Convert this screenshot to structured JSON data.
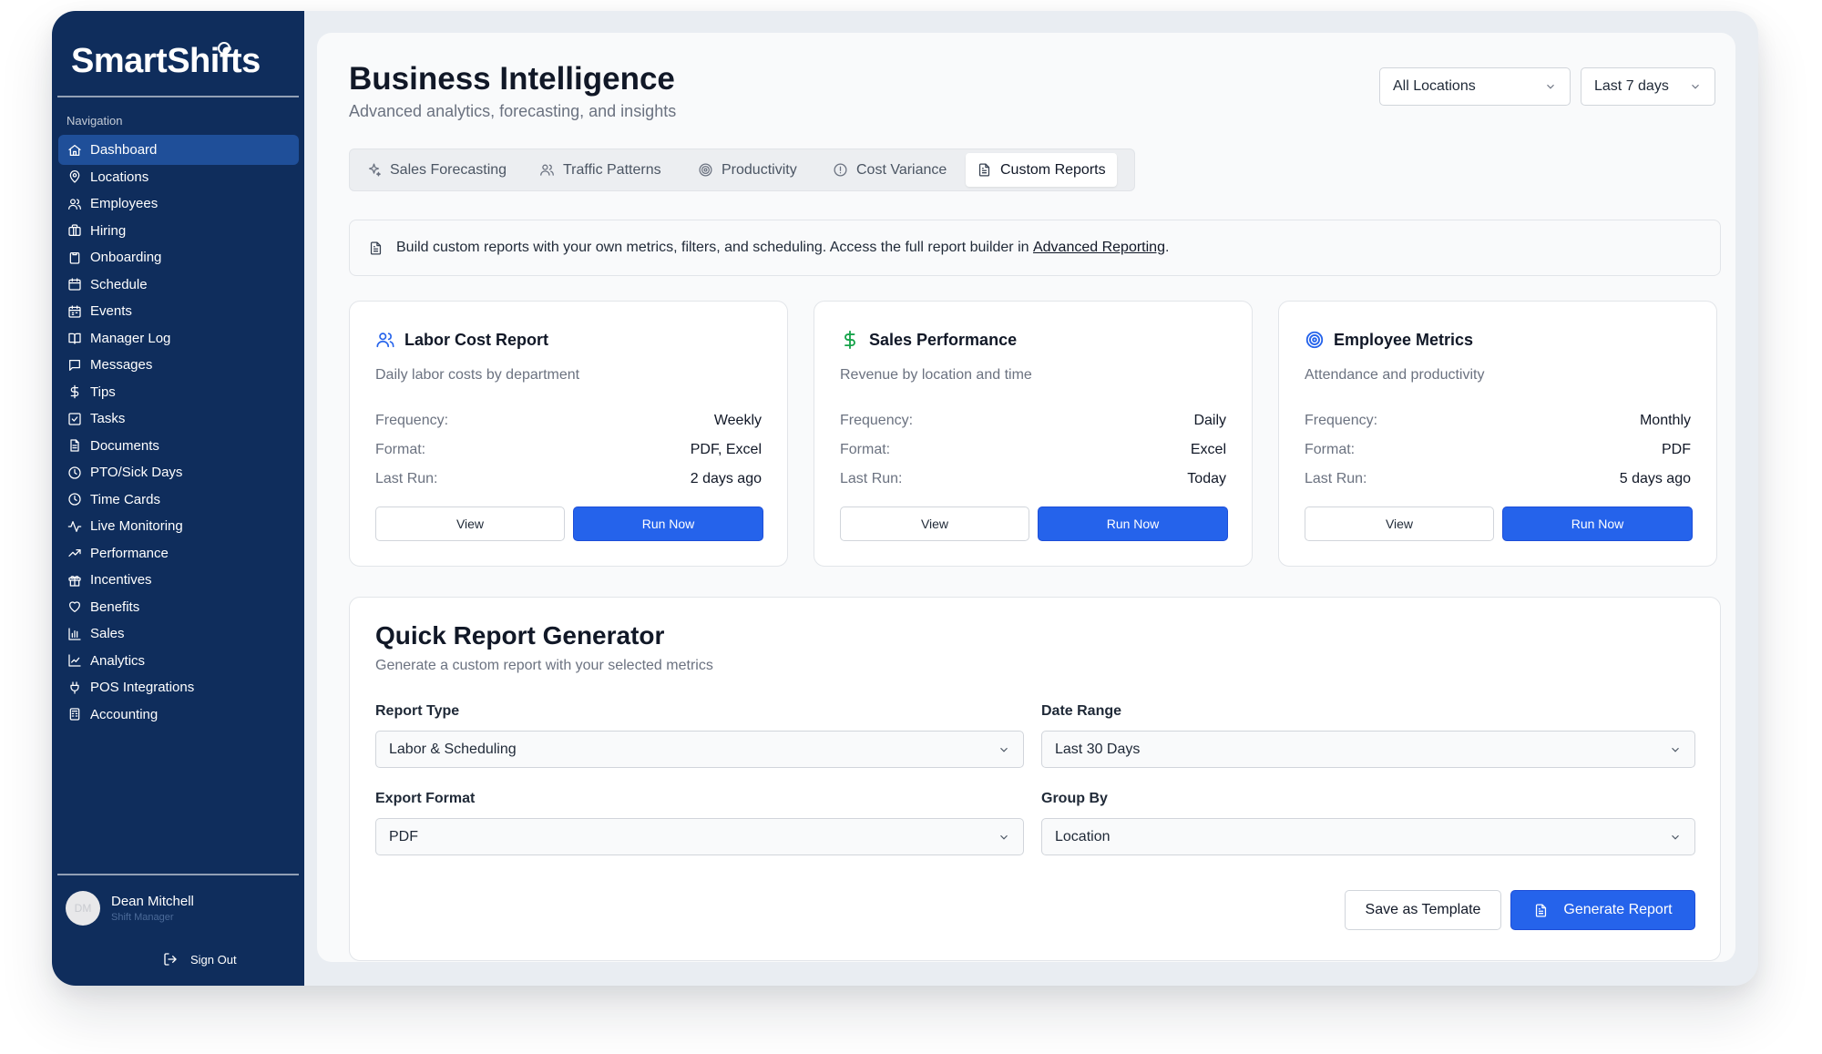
{
  "app": {
    "name": "SmartShifts"
  },
  "sidebar": {
    "heading": "Navigation",
    "items": [
      {
        "label": "Dashboard",
        "icon": "home-icon",
        "active": true
      },
      {
        "label": "Locations",
        "icon": "map-pin-icon"
      },
      {
        "label": "Employees",
        "icon": "users-icon"
      },
      {
        "label": "Hiring",
        "icon": "briefcase-icon"
      },
      {
        "label": "Onboarding",
        "icon": "clipboard-icon"
      },
      {
        "label": "Schedule",
        "icon": "calendar-icon"
      },
      {
        "label": "Events",
        "icon": "calendar-event-icon"
      },
      {
        "label": "Manager Log",
        "icon": "book-icon"
      },
      {
        "label": "Messages",
        "icon": "message-icon"
      },
      {
        "label": "Tips",
        "icon": "dollar-icon"
      },
      {
        "label": "Tasks",
        "icon": "check-square-icon"
      },
      {
        "label": "Documents",
        "icon": "file-icon"
      },
      {
        "label": "PTO/Sick Days",
        "icon": "clock-icon"
      },
      {
        "label": "Time Cards",
        "icon": "clock-icon"
      },
      {
        "label": "Live Monitoring",
        "icon": "activity-icon"
      },
      {
        "label": "Performance",
        "icon": "trending-up-icon"
      },
      {
        "label": "Incentives",
        "icon": "gift-icon"
      },
      {
        "label": "Benefits",
        "icon": "heart-icon"
      },
      {
        "label": "Sales",
        "icon": "bar-chart-icon"
      },
      {
        "label": "Analytics",
        "icon": "line-chart-icon"
      },
      {
        "label": "POS Integrations",
        "icon": "plug-icon"
      },
      {
        "label": "Accounting",
        "icon": "calculator-icon"
      }
    ],
    "user": {
      "initials": "DM",
      "name": "Dean Mitchell",
      "role": "Shift Manager"
    },
    "sign_out": "Sign Out"
  },
  "header": {
    "title": "Business Intelligence",
    "subtitle": "Advanced analytics, forecasting, and insights",
    "location_filter": "All Locations",
    "range_filter": "Last 7 days"
  },
  "tabs": [
    {
      "label": "Sales Forecasting",
      "icon": "sparkles-icon"
    },
    {
      "label": "Traffic Patterns",
      "icon": "users-icon"
    },
    {
      "label": "Productivity",
      "icon": "target-icon"
    },
    {
      "label": "Cost Variance",
      "icon": "alert-circle-icon"
    },
    {
      "label": "Custom Reports",
      "icon": "file-text-icon",
      "active": true
    }
  ],
  "notice": {
    "text": "Build custom reports with your own metrics, filters, and scheduling. Access the full report builder in ",
    "link": "Advanced Reporting",
    "suffix": "."
  },
  "labels": {
    "frequency": "Frequency:",
    "format": "Format:",
    "last_run": "Last Run:",
    "view": "View",
    "run_now": "Run Now"
  },
  "reports": [
    {
      "title": "Labor Cost Report",
      "description": "Daily labor costs by department",
      "frequency": "Weekly",
      "format": "PDF, Excel",
      "last_run": "2 days ago",
      "icon": "users-icon",
      "icon_color": "#2563eb"
    },
    {
      "title": "Sales Performance",
      "description": "Revenue by location and time",
      "frequency": "Daily",
      "format": "Excel",
      "last_run": "Today",
      "icon": "dollar-icon",
      "icon_color": "#16a34a"
    },
    {
      "title": "Employee Metrics",
      "description": "Attendance and productivity",
      "frequency": "Monthly",
      "format": "PDF",
      "last_run": "5 days ago",
      "icon": "target-icon",
      "icon_color": "#2563eb"
    }
  ],
  "quick_report": {
    "title": "Quick Report Generator",
    "subtitle": "Generate a custom report with your selected metrics",
    "report_type": {
      "label": "Report Type",
      "value": "Labor & Scheduling"
    },
    "date_range": {
      "label": "Date Range",
      "value": "Last 30 Days"
    },
    "export_format": {
      "label": "Export Format",
      "value": "PDF"
    },
    "group_by": {
      "label": "Group By",
      "value": "Location"
    },
    "save_template": "Save as Template",
    "generate": "Generate Report"
  },
  "colors": {
    "sidebar": "#0f2d5c",
    "accent": "#2563eb"
  }
}
